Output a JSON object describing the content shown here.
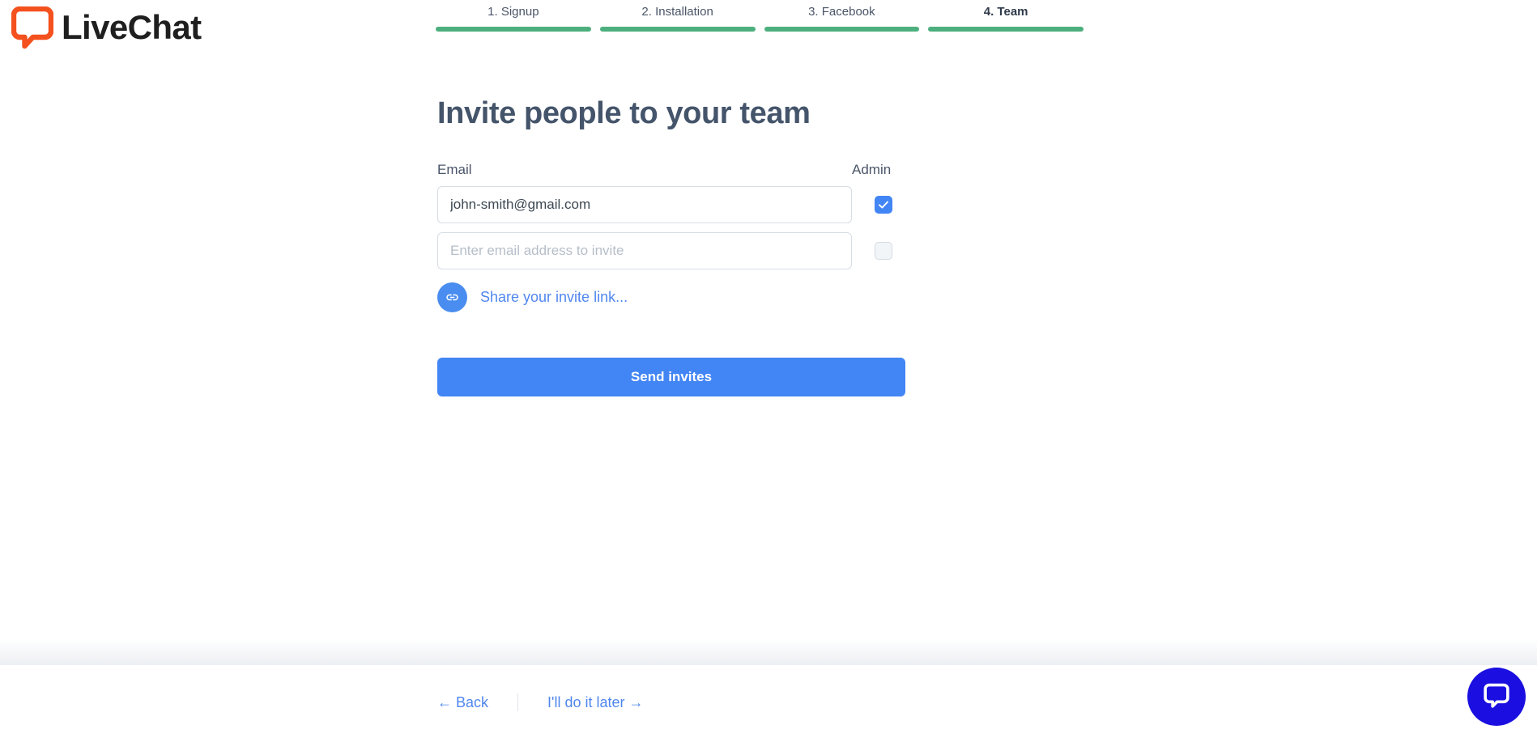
{
  "brand": {
    "name": "LiveChat",
    "logo_color": "#f4511e",
    "accent_blue": "#4285f4",
    "step_green": "#4caf7d",
    "widget_blue": "#1a0fe0"
  },
  "steps": [
    {
      "label": "1. Signup",
      "current": false
    },
    {
      "label": "2. Installation",
      "current": false
    },
    {
      "label": "3. Facebook",
      "current": false
    },
    {
      "label": "4. Team",
      "current": true
    }
  ],
  "main": {
    "title": "Invite people to your team",
    "column_email": "Email",
    "column_admin": "Admin",
    "rows": [
      {
        "value": "john-smith@gmail.com",
        "placeholder": "Enter email address to invite",
        "admin": true
      },
      {
        "value": "",
        "placeholder": "Enter email address to invite",
        "admin": false
      }
    ],
    "share_link_label": "Share your invite link...",
    "submit_label": "Send invites"
  },
  "footer": {
    "back_label": "← Back",
    "later_label": "I'll do it later →"
  },
  "icons": {
    "logo": "speech-bubble-icon",
    "share": "link-icon",
    "widget": "chat-bubble-icon",
    "check": "check-icon"
  }
}
